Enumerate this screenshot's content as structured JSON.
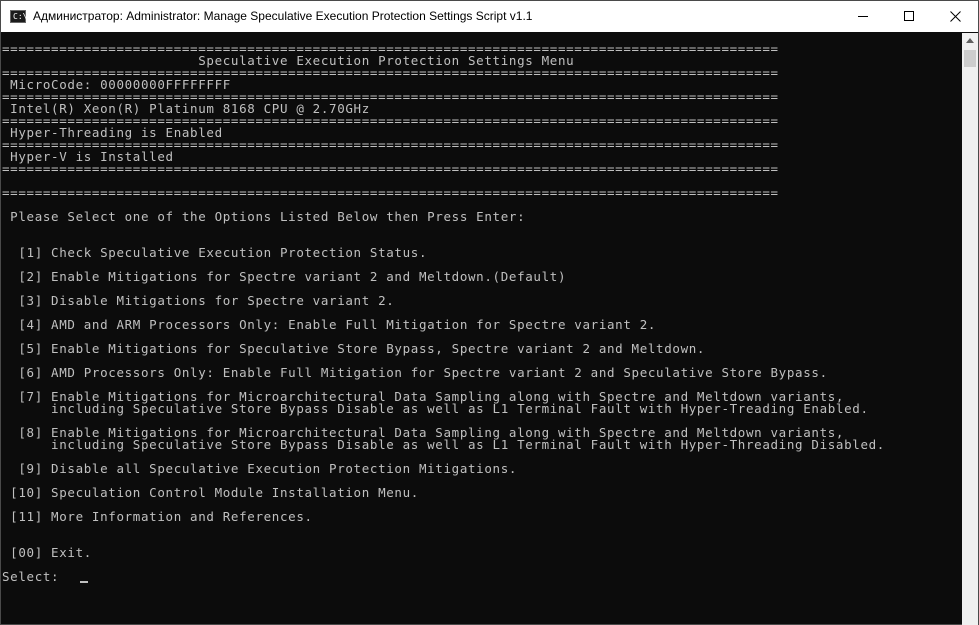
{
  "window": {
    "title": "Администратор: Administrator:  Manage Speculative Execution Protection Settings Script v1.1"
  },
  "console": {
    "lines": [
      "===============================================================================================",
      "                        Speculative Execution Protection Settings Menu",
      "===============================================================================================",
      " MicroCode: 00000000FFFFFFFF",
      "===============================================================================================",
      " Intel(R) Xeon(R) Platinum 8168 CPU @ 2.70GHz",
      "===============================================================================================",
      " Hyper-Threading is Enabled",
      "===============================================================================================",
      " Hyper-V is Installed",
      "===============================================================================================",
      "",
      "===============================================================================================",
      "",
      " Please Select one of the Options Listed Below then Press Enter:",
      "",
      "",
      "  [1] Check Speculative Execution Protection Status.",
      "",
      "  [2] Enable Mitigations for Spectre variant 2 and Meltdown.(Default)",
      "",
      "  [3] Disable Mitigations for Spectre variant 2.",
      "",
      "  [4] AMD and ARM Processors Only: Enable Full Mitigation for Spectre variant 2.",
      "",
      "  [5] Enable Mitigations for Speculative Store Bypass, Spectre variant 2 and Meltdown.",
      "",
      "  [6] AMD Processors Only: Enable Full Mitigation for Spectre variant 2 and Speculative Store Bypass.",
      "",
      "  [7] Enable Mitigations for Microarchitectural Data Sampling along with Spectre and Meltdown variants,",
      "      including Speculative Store Bypass Disable as well as L1 Terminal Fault with Hyper-Treading Enabled.",
      "",
      "  [8] Enable Mitigations for Microarchitectural Data Sampling along with Spectre and Meltdown variants,",
      "      including Speculative Store Bypass Disable as well as L1 Terminal Fault with Hyper-Threading Disabled.",
      "",
      "  [9] Disable all Speculative Execution Protection Mitigations.",
      "",
      " [10] Speculation Control Module Installation Menu.",
      "",
      " [11] More Information and References.",
      "",
      "",
      " [00] Exit.",
      "",
      "Select:  "
    ]
  }
}
